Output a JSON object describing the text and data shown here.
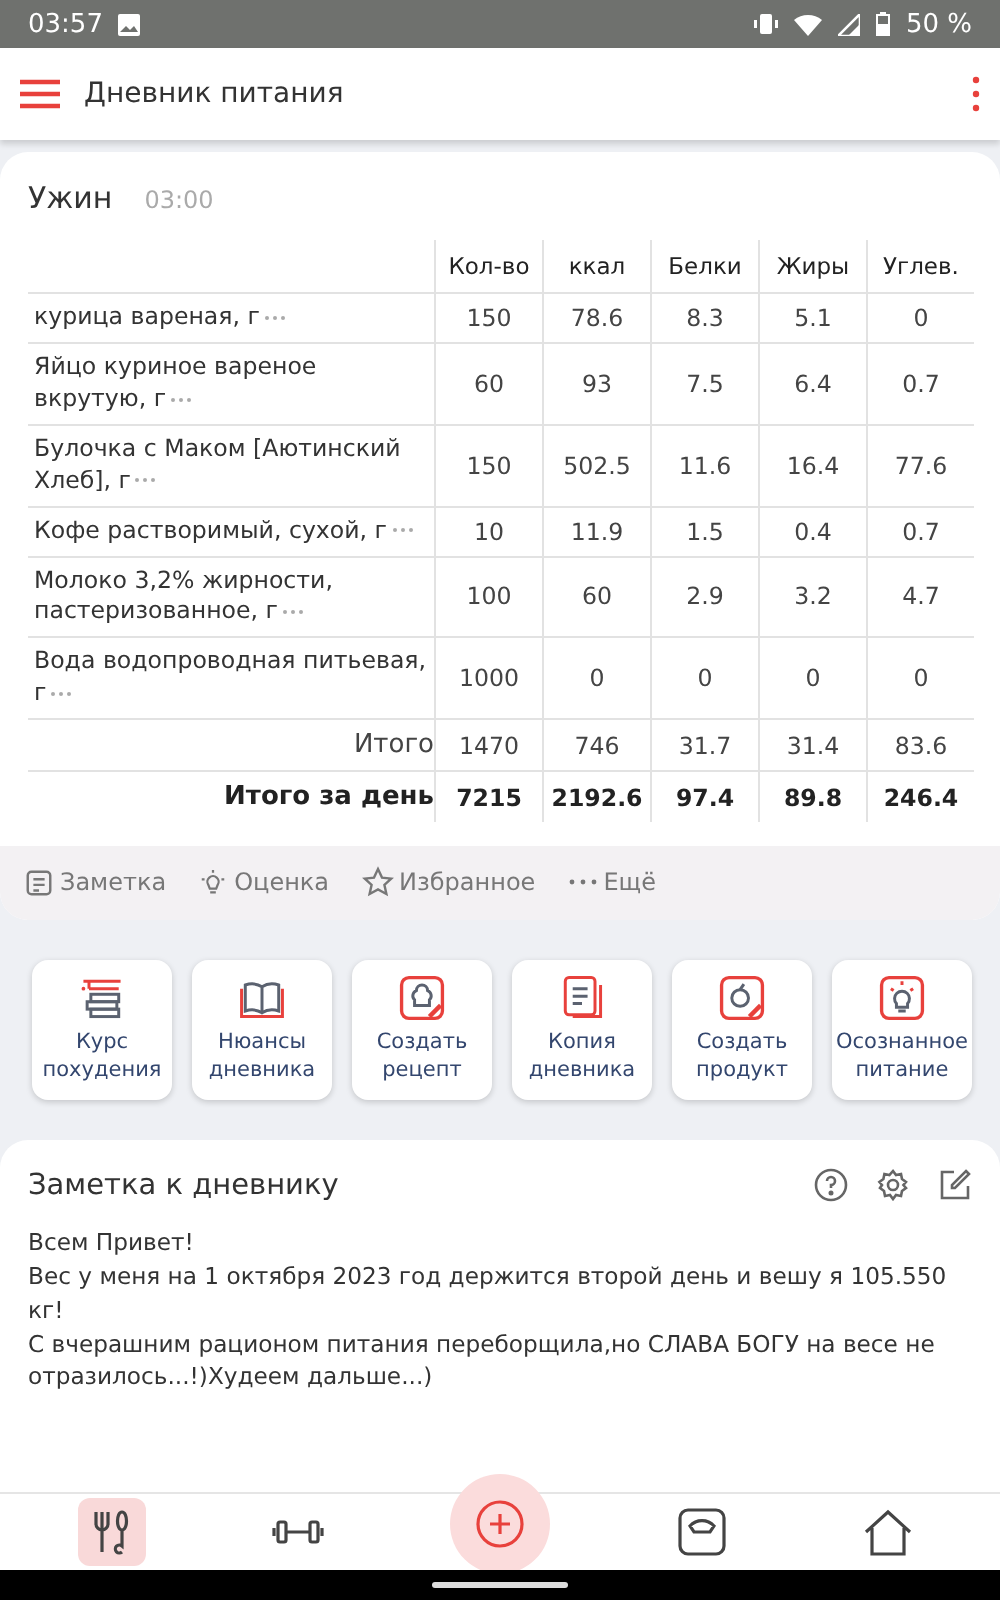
{
  "status_bar": {
    "time": "03:57",
    "battery": "50 %"
  },
  "app_bar": {
    "title": "Дневник питания"
  },
  "meal": {
    "name": "Ужин",
    "time": "03:00",
    "columns": [
      "Кол-во",
      "ккал",
      "Белки",
      "Жиры",
      "Углев."
    ],
    "rows": [
      {
        "name": "курица вареная, г",
        "values": [
          "150",
          "78.6",
          "8.3",
          "5.1",
          "0"
        ]
      },
      {
        "name": "Яйцо куриное вареное вкрутую, г",
        "values": [
          "60",
          "93",
          "7.5",
          "6.4",
          "0.7"
        ]
      },
      {
        "name": "Булочка с Маком [Аютинский Хлеб], г",
        "values": [
          "150",
          "502.5",
          "11.6",
          "16.4",
          "77.6"
        ]
      },
      {
        "name": "Кофе растворимый, сухой, г",
        "values": [
          "10",
          "11.9",
          "1.5",
          "0.4",
          "0.7"
        ]
      },
      {
        "name": "Молоко 3,2% жирности, пастеризованное, г",
        "values": [
          "100",
          "60",
          "2.9",
          "3.2",
          "4.7"
        ]
      },
      {
        "name": "Вода водопроводная питьевая, г",
        "values": [
          "1000",
          "0",
          "0",
          "0",
          "0"
        ]
      }
    ],
    "totals": [
      {
        "label": "Итого",
        "bold": false,
        "values": [
          "1470",
          "746",
          "31.7",
          "31.4",
          "83.6"
        ]
      },
      {
        "label": "Итого за день",
        "bold": true,
        "values": [
          "7215",
          "2192.6",
          "97.4",
          "89.8",
          "246.4"
        ]
      }
    ],
    "actions": [
      {
        "kind": "note",
        "label": "Заметка"
      },
      {
        "kind": "rate",
        "label": "Оценка"
      },
      {
        "kind": "favorite",
        "label": "Избранное"
      },
      {
        "kind": "more",
        "label": "Ещё"
      }
    ]
  },
  "shortcuts": [
    {
      "kind": "course",
      "label": "Курс похудения"
    },
    {
      "kind": "book",
      "label": "Нюансы дневника"
    },
    {
      "kind": "recipe",
      "label": "Создать рецепт"
    },
    {
      "kind": "copy",
      "label": "Копия дневника"
    },
    {
      "kind": "product",
      "label": "Создать продукт"
    },
    {
      "kind": "mindful",
      "label": "Осознанное питание"
    }
  ],
  "note": {
    "title": "Заметка к дневнику",
    "lines": [
      "Всем Привет!",
      "Вес у меня на 1 октября 2023 год держится второй день и вешу я 105.550 кг!",
      "С вчерашним рационом питания переборщила,но СЛАВА БОГУ на весе не отразилось...!)Худеем дальше...)"
    ]
  },
  "bottom_nav": [
    {
      "kind": "diary",
      "selected": true
    },
    {
      "kind": "workout",
      "selected": false
    },
    {
      "kind": "add",
      "selected": false
    },
    {
      "kind": "weight",
      "selected": false
    },
    {
      "kind": "home",
      "selected": false
    }
  ]
}
